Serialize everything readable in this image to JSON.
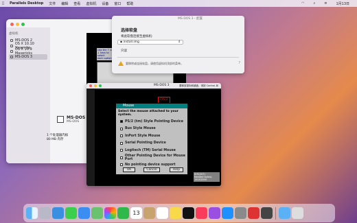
{
  "menubar": {
    "items": [
      "Parallels Desktop",
      "文件",
      "编辑",
      "查看",
      "虚拟机",
      "设备",
      "窗口",
      "帮助"
    ],
    "date": "1月13日"
  },
  "control_center": {
    "sidebar_header": "虚拟机",
    "vms": [
      "MS-DOS 2",
      "OS X 10.10 Yosemite",
      "OS X 10.9 Mavericks",
      "MS-DOS 3"
    ],
    "selected": "MS-DOS 3",
    "detail_name": "MS-DOS",
    "detail_os": "MS-DOS",
    "stats": [
      "1 个处理器内核",
      "80 MB 内存"
    ]
  },
  "dos_back": {
    "heading_lines": [
      "Use the ↑ and ↓ keys to select",
      "each option."
    ]
  },
  "floppy_sheet": {
    "window_title": "MS-DOS 3 - 配置",
    "title": "选择软盘",
    "subtitle": "将此软盘连接至虚拟机:",
    "selected_file": "install.img",
    "section": "只读",
    "info": "要移除或连接软盘，请使用虚拟机顶部的菜单。"
  },
  "vm_window": {
    "title": "MS-DOS 3",
    "hint": "要释放鼠标和键盘，请按 Control-⌘",
    "bg_list": [
      "Logitech (TM) Serial Mouse",
      "Other Pointing Device for Mouse Port"
    ]
  },
  "mouse_dialog": {
    "title": "Mouse",
    "prompt": "Select the mouse attached to your system.",
    "options": [
      "PS/2 (tm) Style Pointing Device",
      "Bus Style Mouse",
      "InPort Style Mouse",
      "Serial Pointing Device",
      "Logitech (TM) Serial Mouse",
      "Other Pointing Device for Mouse Port",
      "No pointing device support"
    ],
    "selected_index": 0,
    "buttons": {
      "ok": "OK",
      "cancel": "Cancel",
      "help": "Help"
    }
  },
  "dos_side_text": [
    "ISTI(207)",
    "Needed bytes)",
    "19253399"
  ],
  "dock": {
    "calendar_day": "13"
  }
}
